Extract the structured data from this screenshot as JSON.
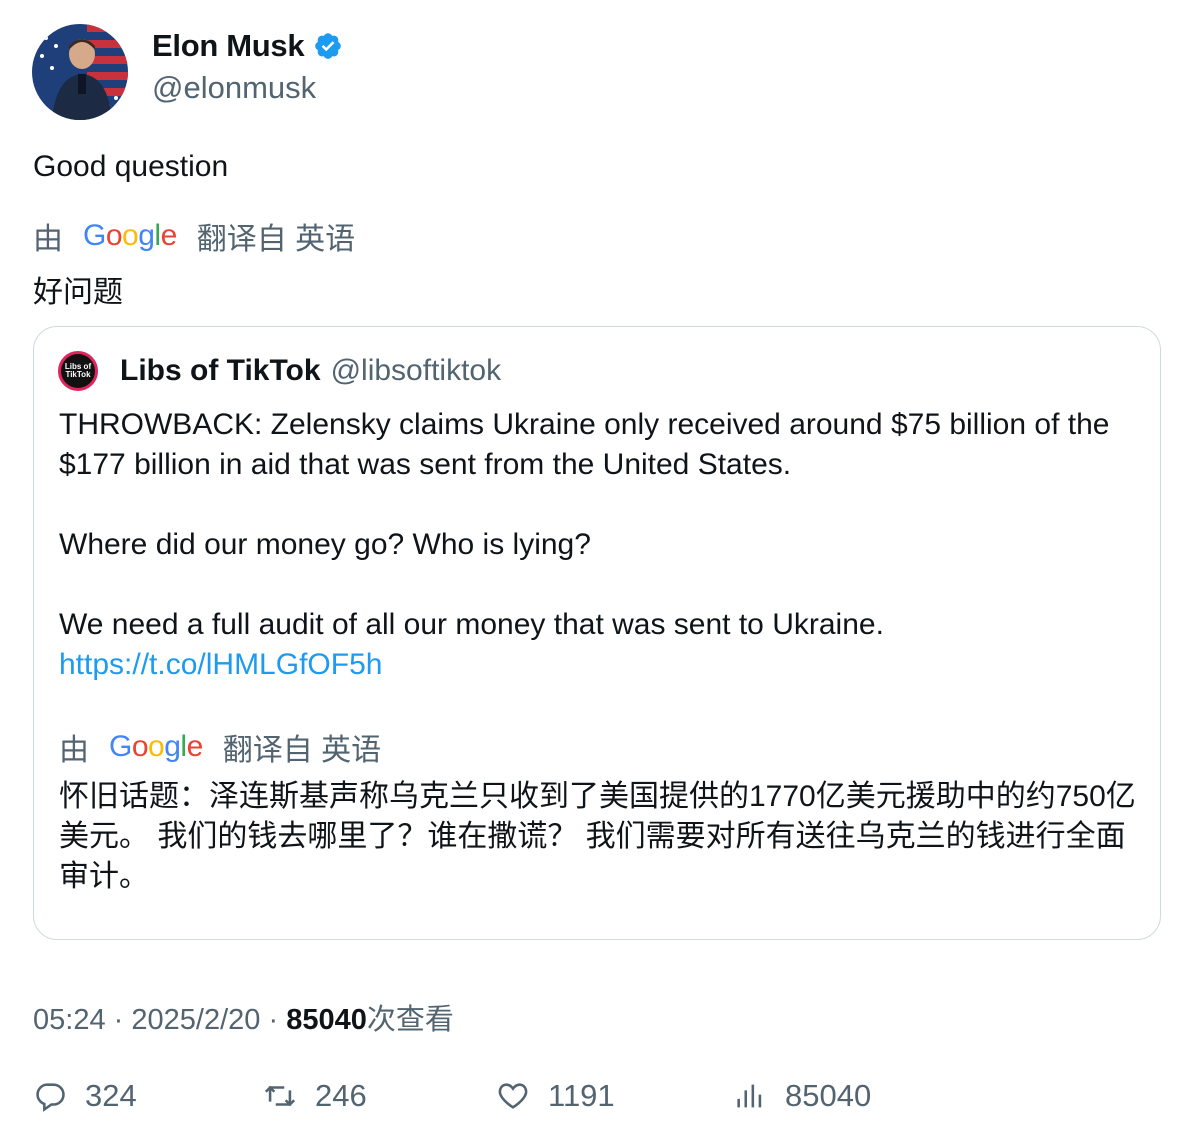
{
  "author": {
    "name": "Elon Musk",
    "handle": "@elonmusk",
    "verified_icon": "verified-badge-icon"
  },
  "tweet": {
    "text": "Good question",
    "translation_prefix": "由",
    "translation_provider": "Google",
    "translation_suffix": "翻译自 英语",
    "translated_text": "好问题"
  },
  "quote": {
    "author_name": "Libs of TikTok",
    "author_handle": "@libsoftiktok",
    "avatar_label": "Libs of TikTok",
    "paragraph1": "THROWBACK: Zelensky claims Ukraine only received around $75 billion of the $177 billion in aid that was sent from the United States.",
    "paragraph2": "Where did our money go? Who is lying?",
    "paragraph3": "We need a full audit of all our money that was sent to Ukraine.",
    "link": "https://t.co/lHMLGfOF5h",
    "translation_prefix": "由",
    "translation_provider": "Google",
    "translation_suffix": "翻译自 英语",
    "translated_text": "怀旧话题：泽连斯基声称乌克兰只收到了美国提供的1770亿美元援助中的约750亿美元。 我们的钱去哪里了？谁在撒谎？ 我们需要对所有送往乌克兰的钱进行全面审计。"
  },
  "meta": {
    "time": "05:24",
    "separator": "·",
    "date": "2025/2/20",
    "views_count": "85040",
    "views_label": "次查看"
  },
  "actions": {
    "replies": "324",
    "retweets": "246",
    "likes": "1191",
    "views": "85040"
  },
  "colors": {
    "link": "#1d9bf0",
    "secondary_text": "#536471",
    "verified": "#1d9bf0"
  }
}
